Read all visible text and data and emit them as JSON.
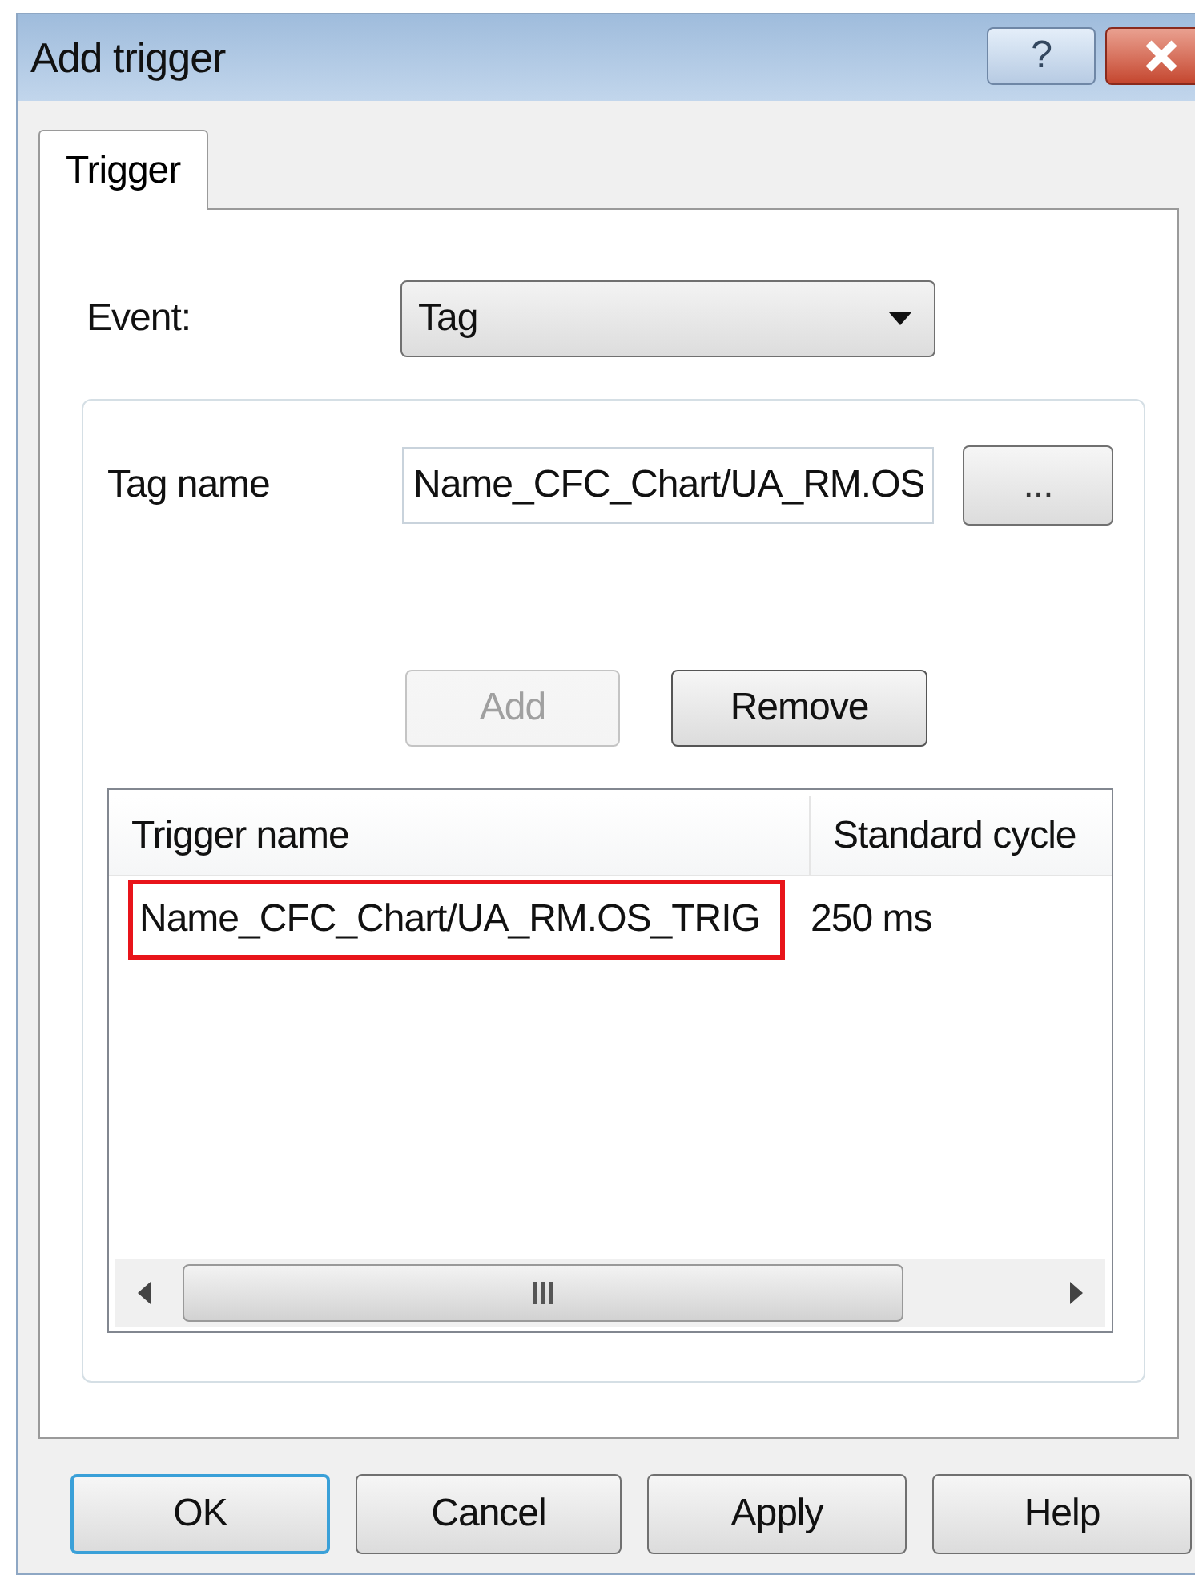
{
  "window": {
    "title": "Add trigger",
    "help_button": "?"
  },
  "tabs": [
    {
      "label": "Trigger",
      "selected": true
    }
  ],
  "event": {
    "label": "Event:",
    "value": "Tag"
  },
  "tag_name": {
    "label": "Tag name",
    "value": "Name_CFC_Chart/UA_RM.OS",
    "browse_button": "..."
  },
  "list_buttons": [
    {
      "label": "Add",
      "disabled": true
    },
    {
      "label": "Remove",
      "disabled": false
    }
  ],
  "table": {
    "columns": [
      "Trigger name",
      "Standard cycle"
    ],
    "rows": [
      {
        "cells": [
          "Name_CFC_Chart/UA_RM.OS_TRIG",
          "250 ms"
        ],
        "highlighted": true
      }
    ]
  },
  "buttons": [
    {
      "label": "OK",
      "default": true
    },
    {
      "label": "Cancel",
      "default": false
    },
    {
      "label": "Apply",
      "default": false
    },
    {
      "label": "Help",
      "default": false
    }
  ]
}
